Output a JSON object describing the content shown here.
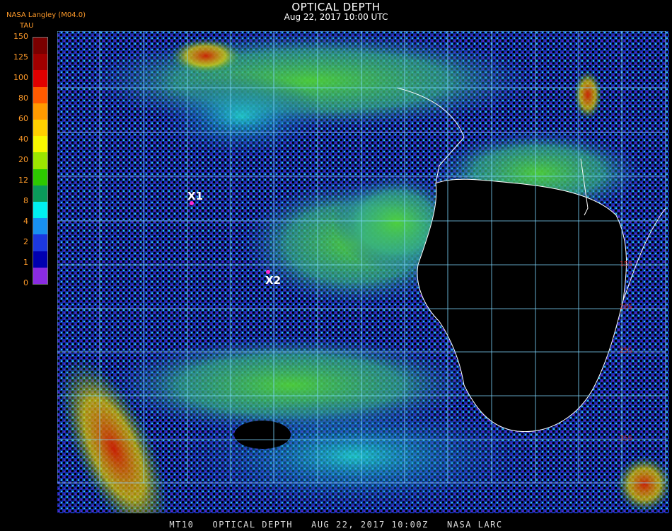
{
  "header": {
    "title": "OPTICAL DEPTH",
    "subtitle": "Aug 22, 2017 10:00 UTC",
    "source": "NASA Langley (M04.0)"
  },
  "legend": {
    "unit_label": "TAU",
    "ticks": [
      "150",
      "125",
      "100",
      "80",
      "60",
      "40",
      "20",
      "12",
      "8",
      "4",
      "2",
      "1",
      "0"
    ],
    "colors": [
      "#7a0000",
      "#a00000",
      "#e00000",
      "#ff5a00",
      "#ff9a00",
      "#ffd000",
      "#f8f800",
      "#9ce600",
      "#2dc800",
      "#0a9a5a",
      "#00f0f0",
      "#1890f0",
      "#1c38e0",
      "#0000b0",
      "#8a2be2"
    ]
  },
  "markers": [
    {
      "label": "X1"
    },
    {
      "label": "X2"
    }
  ],
  "latitude_labels": [
    "15S",
    "20S",
    "25S",
    "35S"
  ],
  "footer": "MT10   OPTICAL DEPTH   AUG 22, 2017 10:00Z   NASA LARC"
}
